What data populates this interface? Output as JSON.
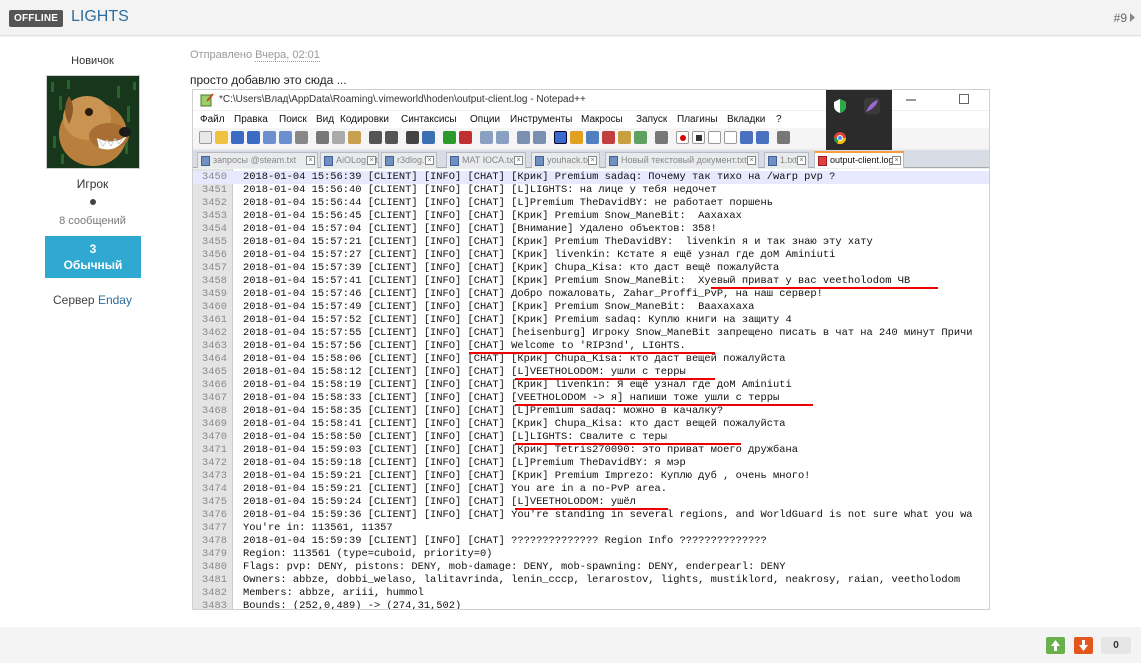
{
  "header": {
    "status_badge": "OFFLINE",
    "author": "LIGHTS",
    "post_number": "#9"
  },
  "author_panel": {
    "rank_title": "Новичок",
    "group": "Игрок",
    "posts": "8 сообщений",
    "reputation_value": "3",
    "reputation_label": "Обычный",
    "server_prefix": "Сервер",
    "server_name": "Enday"
  },
  "post": {
    "posted_prefix": "Отправлено",
    "posted_time": "Вчера, 02:01",
    "text": "просто добавлю это сюда ..."
  },
  "notepad": {
    "title": "*C:\\Users\\Влад\\AppData\\Roaming\\.vimeworld\\hoden\\output-client.log - Notepad++",
    "menu": [
      "Файл",
      "Правка",
      "Поиск",
      "Вид",
      "Кодировки",
      "Синтаксисы",
      "Опции",
      "Инструменты",
      "Макросы",
      "Запуск",
      "Плагины",
      "Вкладки",
      "?"
    ],
    "tabs": [
      "запросы @steam.txt",
      "AiOLog.txt",
      "r3dlog.txt",
      "МАТ ЮСА.txt",
      "youhack.txt",
      "Новый текстовый документ.txt",
      "1.txt",
      "output-client.log"
    ],
    "active_tab": 7,
    "lines": [
      {
        "n": "3450",
        "t": "2018-01-04 15:56:39 [CLIENT] [INFO] [CHAT] [Крик] Premium sadaq: Почему так тихо на /warp pvp ?"
      },
      {
        "n": "3451",
        "t": "2018-01-04 15:56:40 [CLIENT] [INFO] [CHAT] [L]LIGHTS: на лице у тебя недочет"
      },
      {
        "n": "3452",
        "t": "2018-01-04 15:56:44 [CLIENT] [INFO] [CHAT] [L]Premium TheDavidBY: не работает поршень"
      },
      {
        "n": "3453",
        "t": "2018-01-04 15:56:45 [CLIENT] [INFO] [CHAT] [Крик] Premium Snow_ManeBit:  Аахахах"
      },
      {
        "n": "3454",
        "t": "2018-01-04 15:57:04 [CLIENT] [INFO] [CHAT] [Внимание] Удалено объектов: 358!"
      },
      {
        "n": "3455",
        "t": "2018-01-04 15:57:21 [CLIENT] [INFO] [CHAT] [Крик] Premium TheDavidBY:  livenkin я и так знаю эту хату"
      },
      {
        "n": "3456",
        "t": "2018-01-04 15:57:27 [CLIENT] [INFO] [CHAT] [Крик] livenkin: Кстате я ещё узнал где доМ Aminiuti"
      },
      {
        "n": "3457",
        "t": "2018-01-04 15:57:39 [CLIENT] [INFO] [CHAT] [Крик] Chupa_Kisa: кто даст вещё пожалуйста"
      },
      {
        "n": "3458",
        "t": "2018-01-04 15:57:41 [CLIENT] [INFO] [CHAT] [Крик] Premium Snow_ManeBit:  Хуевый приват у вас veetholodom ЧВ"
      },
      {
        "n": "3459",
        "t": "2018-01-04 15:57:46 [CLIENT] [INFO] [CHAT] Добро пожаловать, Zahar_Proffi_PvP, на наш сервер!"
      },
      {
        "n": "3460",
        "t": "2018-01-04 15:57:49 [CLIENT] [INFO] [CHAT] [Крик] Premium Snow_ManeBit:  Ваахахаха"
      },
      {
        "n": "3461",
        "t": "2018-01-04 15:57:52 [CLIENT] [INFO] [CHAT] [Крик] Premium sadaq: Куплю книги на защиту 4"
      },
      {
        "n": "3462",
        "t": "2018-01-04 15:57:55 [CLIENT] [INFO] [CHAT] [heisenburg] Игроку Snow_ManeBit запрещено писать в чат на 240 минут Причи"
      },
      {
        "n": "3463",
        "t": "2018-01-04 15:57:56 [CLIENT] [INFO] [CHAT] Welcome to 'RIP3nd', LIGHTS."
      },
      {
        "n": "3464",
        "t": "2018-01-04 15:58:06 [CLIENT] [INFO] [CHAT] [Крик] Chupa_Kisa: кто даст вещей пожалуйста"
      },
      {
        "n": "3465",
        "t": "2018-01-04 15:58:12 [CLIENT] [INFO] [CHAT] [L]VEETHOLODOM: ушли с терры"
      },
      {
        "n": "3466",
        "t": "2018-01-04 15:58:19 [CLIENT] [INFO] [CHAT] [Крик] livenkin: Я ещё узнал где доМ Aminiuti"
      },
      {
        "n": "3467",
        "t": "2018-01-04 15:58:33 [CLIENT] [INFO] [CHAT] [VEETHOLODOM -> я] напиши тоже ушли с терры"
      },
      {
        "n": "3468",
        "t": "2018-01-04 15:58:35 [CLIENT] [INFO] [CHAT] [L]Premium sadaq: можно в качалку?"
      },
      {
        "n": "3469",
        "t": "2018-01-04 15:58:41 [CLIENT] [INFO] [CHAT] [Крик] Chupa_Kisa: кто даст вещей пожалуйста"
      },
      {
        "n": "3470",
        "t": "2018-01-04 15:58:50 [CLIENT] [INFO] [CHAT] [L]LIGHTS: Свалите с теры"
      },
      {
        "n": "3471",
        "t": "2018-01-04 15:59:03 [CLIENT] [INFO] [CHAT] [Крик] Tetris270090: это приват моего дружбана"
      },
      {
        "n": "3472",
        "t": "2018-01-04 15:59:18 [CLIENT] [INFO] [CHAT] [L]Premium TheDavidBY: я мэр"
      },
      {
        "n": "3473",
        "t": "2018-01-04 15:59:21 [CLIENT] [INFO] [CHAT] [Крик] Premium Imprezo: Куплю дуб , очень много!"
      },
      {
        "n": "3474",
        "t": "2018-01-04 15:59:21 [CLIENT] [INFO] [CHAT] You are in a no-PvP area."
      },
      {
        "n": "3475",
        "t": "2018-01-04 15:59:24 [CLIENT] [INFO] [CHAT] [L]VEETHOLODOM: ушёл"
      },
      {
        "n": "3476",
        "t": "2018-01-04 15:59:36 [CLIENT] [INFO] [CHAT] You're standing in several regions, and WorldGuard is not sure what you wa"
      },
      {
        "n": "3477",
        "t": "You're in: 113561, 11357"
      },
      {
        "n": "3478",
        "t": "2018-01-04 15:59:39 [CLIENT] [INFO] [CHAT] ?????????????? Region Info ??????????????"
      },
      {
        "n": "3479",
        "t": "Region: 113561 (type=cuboid, priority=0)"
      },
      {
        "n": "3480",
        "t": "Flags: pvp: DENY, pistons: DENY, mob-damage: DENY, mob-spawning: DENY, enderpearl: DENY"
      },
      {
        "n": "3481",
        "t": "Owners: abbze, dobbi_welaso, lalitavrinda, lenin_cccp, lerarostov, lights, mustiklord, neakrosy, raian, veetholodom"
      },
      {
        "n": "3482",
        "t": "Members: abbze, ariii, hummol"
      },
      {
        "n": "3483",
        "t": "Bounds: (252,0,489) -> (274,31,502)"
      }
    ]
  },
  "votes": {
    "count": "0"
  },
  "colors": {
    "accent_link": "#2e6d9e",
    "reputation_bg": "#2fa9d1",
    "vote_up": "#6ab04c",
    "vote_down": "#e2571e",
    "highlight_underline": "#e00000"
  }
}
